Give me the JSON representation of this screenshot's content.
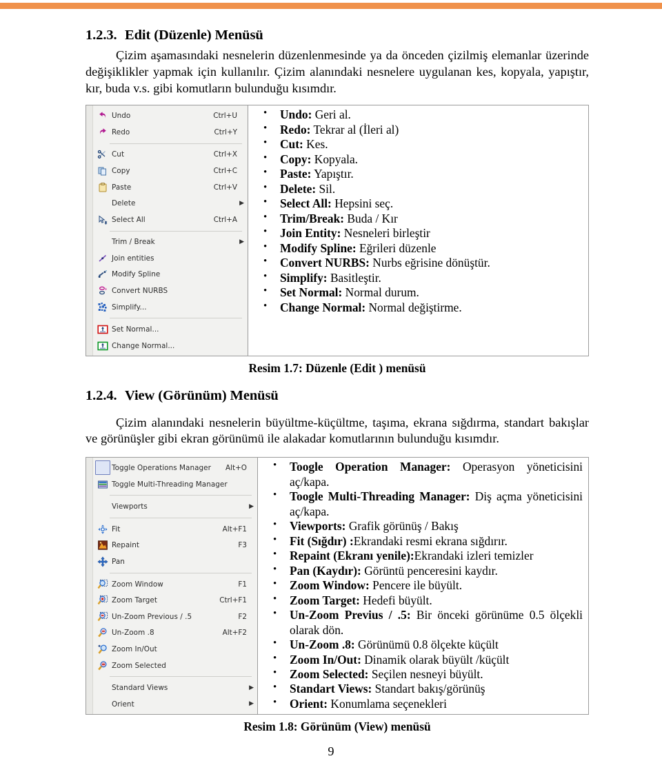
{
  "page": {
    "number": "9",
    "accent_color": "#f0914a"
  },
  "sections": [
    {
      "number": "1.2.3.",
      "title": "Edit (Düzenle) Menüsü",
      "paragraph": "Çizim aşamasındaki nesnelerin düzenlenmesinde ya da önceden çizilmiş elemanlar üzerinde değişiklikler yapmak için kullanılır. Çizim alanındaki nesnelere uygulanan kes, kopyala, yapıştır, kır, buda v.s. gibi komutların bulunduğu kısımdır.",
      "caption": "Resim 1.7: Düzenle (Edit ) menüsü"
    },
    {
      "number": "1.2.4.",
      "title": "View (Görünüm) Menüsü",
      "paragraph": "Çizim alanındaki nesnelerin büyültme-küçültme, taşıma, ekrana sığdırma, standart bakışlar ve görünüşler gibi ekran görünümü ile alakadar komutlarının bulunduğu kısımdır.",
      "caption": "Resim 1.8: Görünüm (View) menüsü"
    }
  ],
  "edit_menu": {
    "items": [
      {
        "icon": "undo-icon",
        "label": "Undo",
        "shortcut": "Ctrl+U",
        "submenu": false
      },
      {
        "icon": "redo-icon",
        "label": "Redo",
        "shortcut": "Ctrl+Y",
        "submenu": false
      },
      {
        "separator": true
      },
      {
        "icon": "cut-icon",
        "label": "Cut",
        "shortcut": "Ctrl+X",
        "submenu": false
      },
      {
        "icon": "copy-icon",
        "label": "Copy",
        "shortcut": "Ctrl+C",
        "submenu": false
      },
      {
        "icon": "paste-icon",
        "label": "Paste",
        "shortcut": "Ctrl+V",
        "submenu": false
      },
      {
        "icon": "none",
        "label": "Delete",
        "shortcut": "",
        "submenu": true
      },
      {
        "icon": "select-all-icon",
        "label": "Select All",
        "shortcut": "Ctrl+A",
        "submenu": false
      },
      {
        "separator": true
      },
      {
        "icon": "none",
        "label": "Trim / Break",
        "shortcut": "",
        "submenu": true
      },
      {
        "icon": "join-entities-icon",
        "label": "Join entities",
        "shortcut": "",
        "submenu": false
      },
      {
        "icon": "modify-spline-icon",
        "label": "Modify Spline",
        "shortcut": "",
        "submenu": false
      },
      {
        "icon": "convert-nurbs-icon",
        "label": "Convert NURBS",
        "shortcut": "",
        "submenu": false
      },
      {
        "icon": "simplify-icon",
        "label": "Simplify...",
        "shortcut": "",
        "submenu": false
      },
      {
        "separator": true
      },
      {
        "icon": "set-normal-icon",
        "label": "Set Normal...",
        "shortcut": "",
        "submenu": false
      },
      {
        "icon": "change-normal-icon",
        "label": "Change Normal...",
        "shortcut": "",
        "submenu": false
      }
    ]
  },
  "edit_descriptions": [
    {
      "term": "Undo:",
      "desc": " Geri al."
    },
    {
      "term": "Redo:",
      "desc": " Tekrar al (İleri al)"
    },
    {
      "term": "Cut:",
      "desc": " Kes."
    },
    {
      "term": "Copy:",
      "desc": " Kopyala."
    },
    {
      "term": "Paste:",
      "desc": " Yapıştır."
    },
    {
      "term": "Delete:",
      "desc": " Sil."
    },
    {
      "term": "Select All:",
      "desc": " Hepsini seç."
    },
    {
      "term": "Trim/Break:",
      "desc": " Buda / Kır"
    },
    {
      "term": "Join Entity:",
      "desc": " Nesneleri birleştir"
    },
    {
      "term": "Modify Spline:",
      "desc": " Eğrileri düzenle"
    },
    {
      "term": "Convert NURBS:",
      "desc": " Nurbs eğrisine dönüştür."
    },
    {
      "term": "Simplify:",
      "desc": " Basitleştir."
    },
    {
      "term": "Set Normal:",
      "desc": " Normal durum."
    },
    {
      "term": "Change Normal:",
      "desc": " Normal değiştirme."
    }
  ],
  "view_menu": {
    "items": [
      {
        "icon": "operations-manager-icon",
        "label": "Toggle Operations Manager",
        "shortcut": "Alt+O",
        "submenu": false,
        "selected": true
      },
      {
        "icon": "multi-threading-icon",
        "label": "Toggle Multi-Threading Manager",
        "shortcut": "",
        "submenu": false
      },
      {
        "separator": true
      },
      {
        "icon": "none",
        "label": "Viewports",
        "shortcut": "",
        "submenu": true
      },
      {
        "separator": true
      },
      {
        "icon": "fit-icon",
        "label": "Fit",
        "shortcut": "Alt+F1",
        "submenu": false
      },
      {
        "icon": "repaint-icon",
        "label": "Repaint",
        "shortcut": "F3",
        "submenu": false
      },
      {
        "icon": "pan-icon",
        "label": "Pan",
        "shortcut": "",
        "submenu": false
      },
      {
        "separator": true
      },
      {
        "icon": "zoom-window-icon",
        "label": "Zoom Window",
        "shortcut": "F1",
        "submenu": false
      },
      {
        "icon": "zoom-target-icon",
        "label": "Zoom Target",
        "shortcut": "Ctrl+F1",
        "submenu": false
      },
      {
        "icon": "un-zoom-previous-icon",
        "label": "Un-Zoom Previous / .5",
        "shortcut": "F2",
        "submenu": false
      },
      {
        "icon": "un-zoom-eight-icon",
        "label": "Un-Zoom .8",
        "shortcut": "Alt+F2",
        "submenu": false
      },
      {
        "icon": "zoom-in-out-icon",
        "label": "Zoom In/Out",
        "shortcut": "",
        "submenu": false
      },
      {
        "icon": "zoom-selected-icon",
        "label": "Zoom Selected",
        "shortcut": "",
        "submenu": false
      },
      {
        "separator": true
      },
      {
        "icon": "none",
        "label": "Standard Views",
        "shortcut": "",
        "submenu": true
      },
      {
        "icon": "none",
        "label": "Orient",
        "shortcut": "",
        "submenu": true
      }
    ]
  },
  "view_descriptions": [
    {
      "term": "Toogle Operation Manager:",
      "desc": " Operasyon yöneticisini aç/kapa.",
      "justify": true
    },
    {
      "term": "Toogle Multi-Threading Manager:",
      "desc": " Diş açma yöneticisini aç/kapa.",
      "justify": true
    },
    {
      "term": "Viewports:",
      "desc": " Grafik görünüş / Bakış"
    },
    {
      "term": "Fit  (Sığdır) :",
      "desc": "Ekrandaki resmi ekrana sığdırır."
    },
    {
      "term": "Repaint (Ekranı yenile):",
      "desc": "Ekrandaki izleri temizler"
    },
    {
      "term": "Pan (Kaydır):",
      "desc": " Görüntü penceresini kaydır."
    },
    {
      "term": "Zoom Window:",
      "desc": " Pencere ile büyült."
    },
    {
      "term": "Zoom Target:",
      "desc": " Hedefi büyült."
    },
    {
      "term": "Un-Zoom Previus / .5:",
      "desc": " Bir önceki görünüme 0.5 ölçekli olarak dön.",
      "justify": true
    },
    {
      "term": "Un-Zoom .8:",
      "desc": " Görünümü 0.8 ölçekte küçült"
    },
    {
      "term": "Zoom In/Out:",
      "desc": " Dinamik olarak büyült /küçült"
    },
    {
      "term": "Zoom Selected:",
      "desc": " Seçilen nesneyi büyült."
    },
    {
      "term": "Standart Views:",
      "desc": " Standart bakış/görünüş"
    },
    {
      "term": "Orient:",
      "desc": " Konumlama seçenekleri"
    }
  ]
}
